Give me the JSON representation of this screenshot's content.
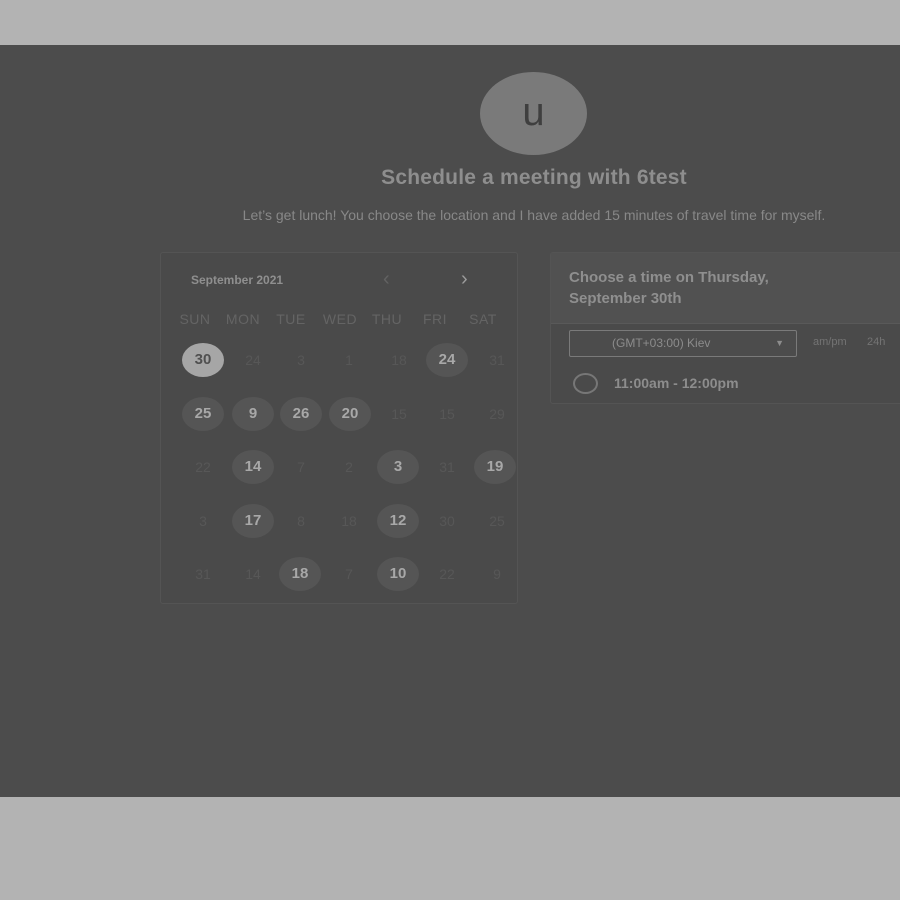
{
  "profile": {
    "initial": "u"
  },
  "header": {
    "title": "Schedule a meeting with 6test",
    "description": "Let’s get lunch! You choose the location and I have added 15 minutes of travel time for myself."
  },
  "calendar": {
    "month": "September 2021",
    "prev_icon": "chevron-left",
    "next_icon": "chevron-right",
    "prev": "‹",
    "next": "›",
    "weekdays": [
      "SUN",
      "MON",
      "TUE",
      "WED",
      "THU",
      "FRI",
      "SAT"
    ],
    "weeks": [
      [
        "30",
        "24",
        "3",
        "1",
        "18",
        "24",
        "31"
      ],
      [
        "25",
        "9",
        "26",
        "20",
        "15",
        "15",
        "29"
      ],
      [
        "22",
        "14",
        "7",
        "2",
        "3",
        "31",
        "19"
      ],
      [
        "3",
        "17",
        "8",
        "18",
        "12",
        "30",
        "25"
      ],
      [
        "31",
        "14",
        "18",
        "7",
        "10",
        "22",
        "9"
      ]
    ],
    "selected": "30"
  },
  "time_panel": {
    "title": "Choose a time on Thursday, September 30th",
    "timezone": "(GMT+03:00) Kiev",
    "format_ampm": "am/pm",
    "format_24h": "24h",
    "slots": [
      "11:00am - 12:00pm"
    ]
  },
  "colors": {
    "page_background": "#4c4c4c",
    "outer_background": "#b3b3b3",
    "available_day": "#555555",
    "selected_day": "#a6a6a6"
  }
}
